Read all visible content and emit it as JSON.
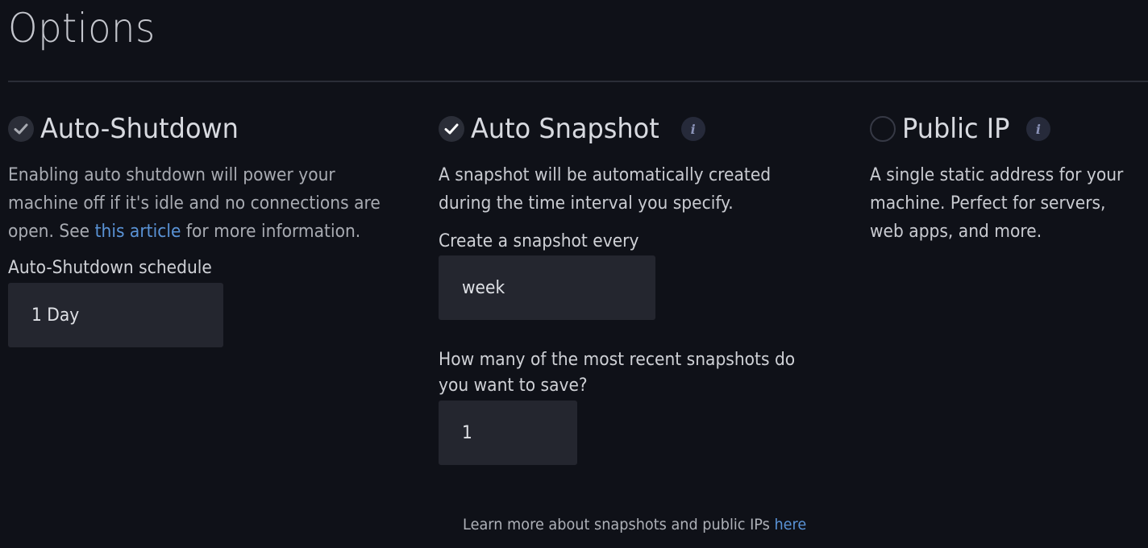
{
  "page": {
    "title": "Options"
  },
  "options": {
    "auto_shutdown": {
      "title": "Auto-Shutdown",
      "checked": true,
      "desc_before_link": "Enabling auto shutdown will power your machine off if it's idle and no connections are open. See ",
      "link_text": "this article",
      "desc_after_link": " for more information.",
      "schedule_label": "Auto-Shutdown schedule",
      "schedule_value": "1 Day"
    },
    "auto_snapshot": {
      "title": "Auto Snapshot",
      "checked": true,
      "desc": "A snapshot will be automatically created during the time interval you specify.",
      "interval_label": "Create a snapshot every",
      "interval_value": "week",
      "count_label": "How many of the most recent snapshots do you want to save?",
      "count_value": "1"
    },
    "public_ip": {
      "title": "Public IP",
      "checked": false,
      "desc": "A single static address for your machine. Perfect for servers, web apps, and more."
    }
  },
  "footer": {
    "text": "Learn more about snapshots and public IPs ",
    "link_text": "here"
  },
  "icons": {
    "check": "check-icon",
    "info": "info-icon"
  },
  "colors": {
    "background": "#0f1118",
    "link": "#5a93d6",
    "field": "#24262f"
  }
}
